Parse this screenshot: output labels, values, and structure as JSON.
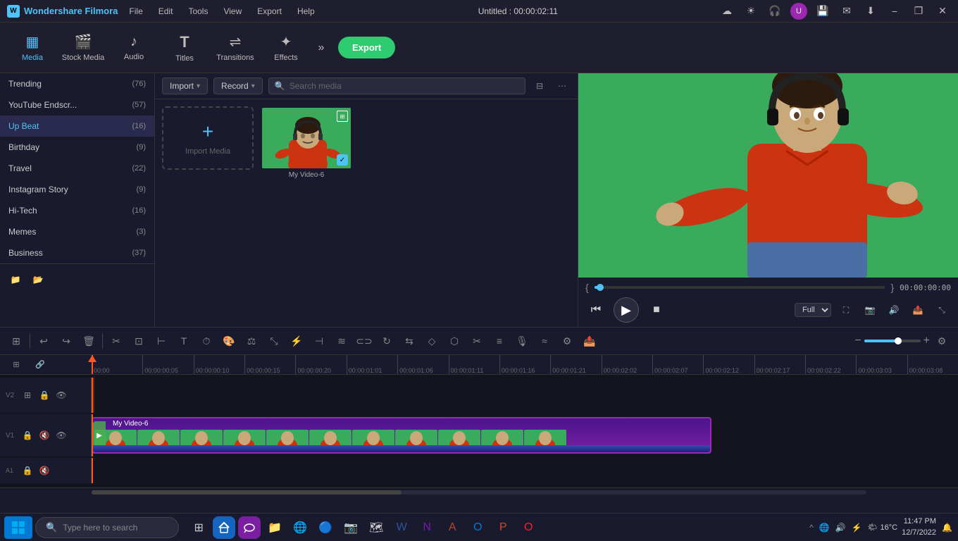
{
  "app": {
    "title": "Wondershare Filmora",
    "window_title": "Untitled : 00:00:02:11"
  },
  "title_bar": {
    "menus": [
      "File",
      "Edit",
      "Tools",
      "View",
      "Export",
      "Help"
    ],
    "minimize": "−",
    "maximize": "❐",
    "close": "✕"
  },
  "toolbar": {
    "tabs": [
      {
        "id": "media",
        "label": "Media",
        "icon": "▦"
      },
      {
        "id": "stock",
        "label": "Stock Media",
        "icon": "🎬"
      },
      {
        "id": "audio",
        "label": "Audio",
        "icon": "♪"
      },
      {
        "id": "titles",
        "label": "Titles",
        "icon": "T"
      },
      {
        "id": "transitions",
        "label": "Transitions",
        "icon": "⇌"
      },
      {
        "id": "effects",
        "label": "Effects",
        "icon": "✦"
      }
    ],
    "more_btn": "»",
    "export_label": "Export"
  },
  "left_panel": {
    "items": [
      {
        "label": "Trending",
        "count": "(76)"
      },
      {
        "label": "YouTube Endscr...",
        "count": "(57)"
      },
      {
        "label": "Up Beat",
        "count": "(16)"
      },
      {
        "label": "Birthday",
        "count": "(9)"
      },
      {
        "label": "Travel",
        "count": "(22)"
      },
      {
        "label": "Instagram Story",
        "count": "(9)"
      },
      {
        "label": "Hi-Tech",
        "count": "(16)"
      },
      {
        "label": "Memes",
        "count": "(3)"
      },
      {
        "label": "Business",
        "count": "(37)"
      }
    ]
  },
  "media_panel": {
    "import_label": "Import",
    "record_label": "Record",
    "search_placeholder": "Search media",
    "import_media_label": "Import Media",
    "video_label": "My Video-6"
  },
  "preview": {
    "time_current": "00:00:00:00",
    "time_total": "00:00:00:00",
    "quality": "Full",
    "play_icon": "▶",
    "pause_icon": "⏸",
    "prev_icon": "⏮",
    "next_icon": "⏭",
    "stop_icon": "■"
  },
  "timeline": {
    "ruler_marks": [
      "00:00:00:05",
      "00:00:00:10",
      "00:00:00:15",
      "00:00:00:20",
      "00:00:01:01",
      "00:00:01:06",
      "00:00:01:11",
      "00:00:01:16",
      "00:00:01:21",
      "00:00:02:02",
      "00:00:02:07",
      "00:00:02:12",
      "00:00:02:17",
      "00:00:02:22",
      "00:00:03:03",
      "00:00:03:08"
    ],
    "tracks": [
      {
        "num": "2",
        "type": "video-empty"
      },
      {
        "num": "1",
        "type": "video-main",
        "label": "My Video-6"
      }
    ],
    "audio_track": {
      "num": "1",
      "type": "audio"
    }
  },
  "taskbar": {
    "search_placeholder": "Type here to search",
    "time": "11:47 PM",
    "date": "12/7/2022",
    "temperature": "16°C",
    "apps": [
      "⊞",
      "🔍",
      "📋",
      "💬",
      "📁",
      "🌐",
      "🔵",
      "⚡",
      "📧",
      "📎",
      "🗒️",
      "📓",
      "🟢",
      "🎯"
    ]
  }
}
